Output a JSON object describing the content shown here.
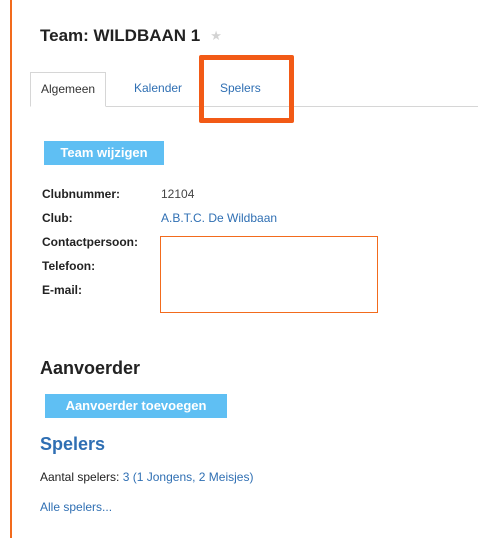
{
  "team": {
    "title": "Team: WILDBAAN 1",
    "favorite_icon": "star-icon"
  },
  "tabs": [
    {
      "label": "Algemeen",
      "active": true
    },
    {
      "label": "Kalender",
      "active": false
    },
    {
      "label": "Spelers",
      "active": false
    }
  ],
  "buttons": {
    "edit_team": "Team wijzigen",
    "add_captain": "Aanvoerder toevoegen"
  },
  "info": {
    "clubnummer_label": "Clubnummer:",
    "clubnummer_value": "12104",
    "club_label": "Club:",
    "club_value": "A.B.T.C. De Wildbaan",
    "contact_label": "Contactpersoon:",
    "telefoon_label": "Telefoon:",
    "email_label": "E-mail:"
  },
  "captain": {
    "heading": "Aanvoerder"
  },
  "players": {
    "heading": "Spelers",
    "count_label": "Aantal spelers:",
    "count_value": "3 (1 Jongens, 2 Meisjes)",
    "all_link": "Alle spelers..."
  },
  "colors": {
    "accent_orange": "#f25a16",
    "button_blue": "#5fbff3",
    "link_blue": "#2f6fb3"
  }
}
